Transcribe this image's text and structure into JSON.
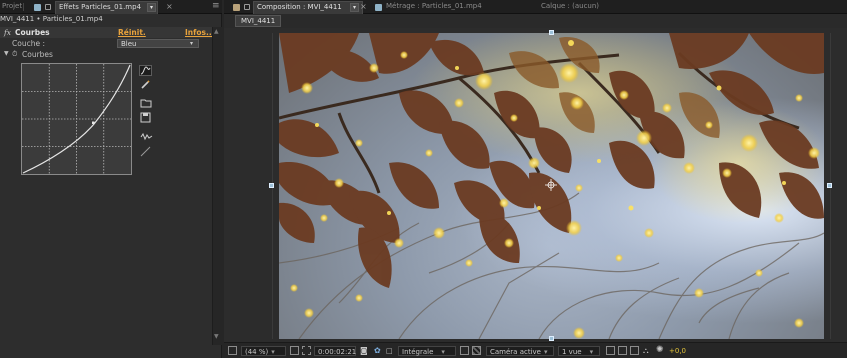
{
  "left_panel": {
    "tabs": {
      "project_label": "Projet",
      "effects_label": "Effets Particles_01.mp4"
    },
    "breadcrumb": "MVI_4411 • Particles_01.mp4",
    "effect": {
      "fx_symbol": "fx",
      "name": "Courbes",
      "reset_label": "Réinit.",
      "info_label": "Infos..."
    },
    "channel": {
      "label": "Couche :",
      "value": "Bleu"
    },
    "sub_property": "Courbes"
  },
  "right_panel": {
    "tabs": {
      "composition_label": "Composition : MVI_4411",
      "footage_label": "Métrage : Particles_01.mp4",
      "layer_label": "Calque : (aucun)"
    },
    "comp_subtab": "MVI_4411",
    "bottom_bar": {
      "zoom": "(44 %)",
      "timecode": "0:00:02:21",
      "resolution": "Intégrale",
      "camera": "Caméra active",
      "views": "1 vue",
      "exposure": "+0,0"
    }
  },
  "colors": {
    "panel_bg": "#2d2d2d",
    "accent_orange": "#e8a33c",
    "exposure_yellow": "#e3c43a",
    "curve_white": "#e6e6e6"
  },
  "icons": [
    "lock-icon",
    "menu-arrow-icon",
    "close-icon",
    "curve-tool-icon",
    "pencil-icon",
    "folder-open-icon",
    "save-icon",
    "smooth-icon",
    "linear-icon",
    "camera-icon",
    "color-wheel-icon",
    "grid-icon",
    "expose-icon"
  ]
}
